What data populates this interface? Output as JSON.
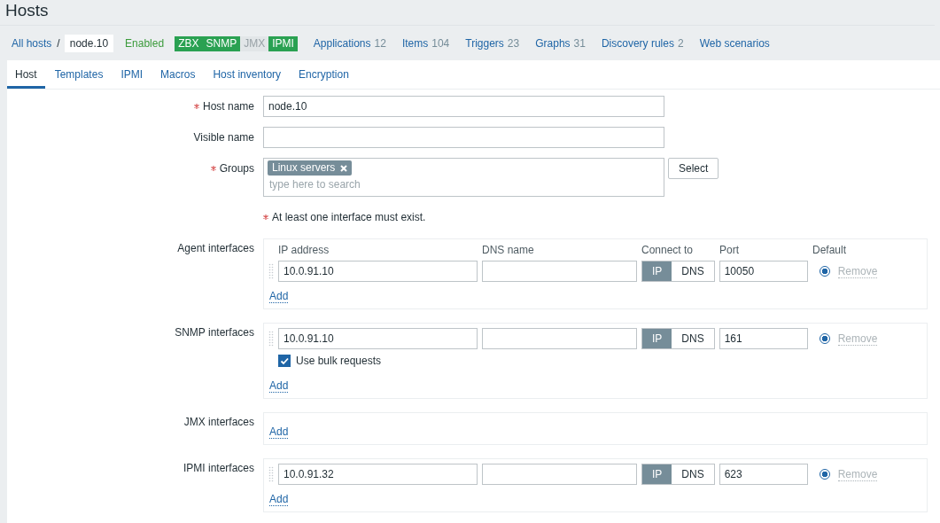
{
  "title": "Hosts",
  "breadcrumb": {
    "root": "All hosts",
    "separator": "/",
    "current": "node.10"
  },
  "status": "Enabled",
  "availability": [
    {
      "label": "ZBX",
      "on": true
    },
    {
      "label": "SNMP",
      "on": true
    },
    {
      "label": "JMX",
      "on": false
    },
    {
      "label": "IPMI",
      "on": true
    }
  ],
  "links": [
    {
      "label": "Applications",
      "count": "12"
    },
    {
      "label": "Items",
      "count": "104"
    },
    {
      "label": "Triggers",
      "count": "23"
    },
    {
      "label": "Graphs",
      "count": "31"
    },
    {
      "label": "Discovery rules",
      "count": "2"
    },
    {
      "label": "Web scenarios"
    }
  ],
  "tabs": [
    {
      "label": "Host",
      "selected": true
    },
    {
      "label": "Templates",
      "selected": false
    },
    {
      "label": "IPMI",
      "selected": false
    },
    {
      "label": "Macros",
      "selected": false
    },
    {
      "label": "Host inventory",
      "selected": false
    },
    {
      "label": "Encryption",
      "selected": false
    }
  ],
  "fields": [
    {
      "label": "Host name",
      "required": true,
      "value": "node.10"
    },
    {
      "label": "Visible name",
      "required": false
    }
  ],
  "groups": {
    "label": "Groups",
    "required": true,
    "tags": [
      "Linux servers"
    ],
    "placeholder": "type here to search",
    "button": "Select"
  },
  "note": "At least one interface must exist.",
  "interfaces": [
    {
      "label": "Agent interfaces",
      "headers": [
        "IP address",
        "DNS name",
        "Connect to",
        "Port",
        "Default"
      ],
      "rows": [
        {
          "ip": "10.0.91.10",
          "connect": [
            {
              "label": "IP",
              "selected": true
            },
            {
              "label": "DNS",
              "selected": false
            }
          ],
          "port": "10050",
          "default": true,
          "remove": "Remove"
        }
      ],
      "add": "Add"
    },
    {
      "label": "SNMP interfaces",
      "rows": [
        {
          "ip": "10.0.91.10",
          "connect": [
            {
              "label": "IP",
              "selected": true
            },
            {
              "label": "DNS",
              "selected": false
            }
          ],
          "port": "161",
          "default": true,
          "remove": "Remove",
          "bulk": {
            "label": "Use bulk requests",
            "checked": true
          }
        }
      ],
      "add": "Add"
    },
    {
      "label": "JMX interfaces",
      "add": "Add"
    },
    {
      "label": "IPMI interfaces",
      "rows": [
        {
          "ip": "10.0.91.32",
          "connect": [
            {
              "label": "IP",
              "selected": true
            },
            {
              "label": "DNS",
              "selected": false
            }
          ],
          "port": "623",
          "default": true,
          "remove": "Remove"
        }
      ],
      "add": "Add"
    }
  ]
}
